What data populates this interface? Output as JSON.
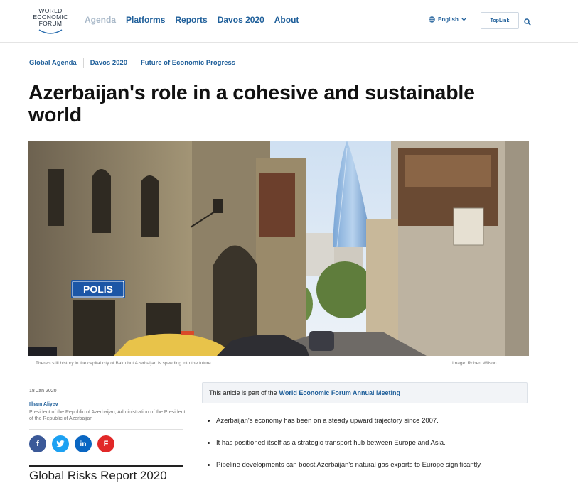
{
  "header": {
    "logo_lines": [
      "WORLD",
      "ECONOMIC",
      "FORUM"
    ],
    "nav": [
      "Agenda",
      "Platforms",
      "Reports",
      "Davos 2020",
      "About"
    ],
    "language": "English",
    "toplink_label": "TopLink"
  },
  "breadcrumbs": [
    "Global Agenda",
    "Davos 2020",
    "Future of Economic Progress"
  ],
  "article": {
    "title": "Azerbaijan's role in a cohesive and sustainable world",
    "hero_sign": "POLIS",
    "caption": "There's still history in the capital city of Baku but Azerbaijan is speeding into the future.",
    "credit": "Image: Robert Wilson",
    "date": "18 Jan 2020",
    "author": "Ilham Aliyev",
    "author_role": "President of the Republic of Azerbaijan, Administration of the President of the Republic of Azerbaijan",
    "next_heading": "Global Risks Report 2020",
    "infobox_prefix": "This article is part of the",
    "infobox_link": "World Economic Forum Annual Meeting",
    "bullets": [
      "Azerbaijan's economy has been on a steady upward trajectory since 2007.",
      "It has positioned itself as a strategic transport hub between Europe and Asia.",
      "Pipeline developments can boost Azerbaijan's natural gas exports to Europe significantly."
    ]
  },
  "share": [
    "f",
    "t",
    "in",
    "F"
  ],
  "colors": {
    "brand_blue": "#1f5f9a",
    "facebook": "#3b5998",
    "twitter": "#1da1f2",
    "linkedin": "#0a66c2",
    "flipboard": "#e12828"
  }
}
